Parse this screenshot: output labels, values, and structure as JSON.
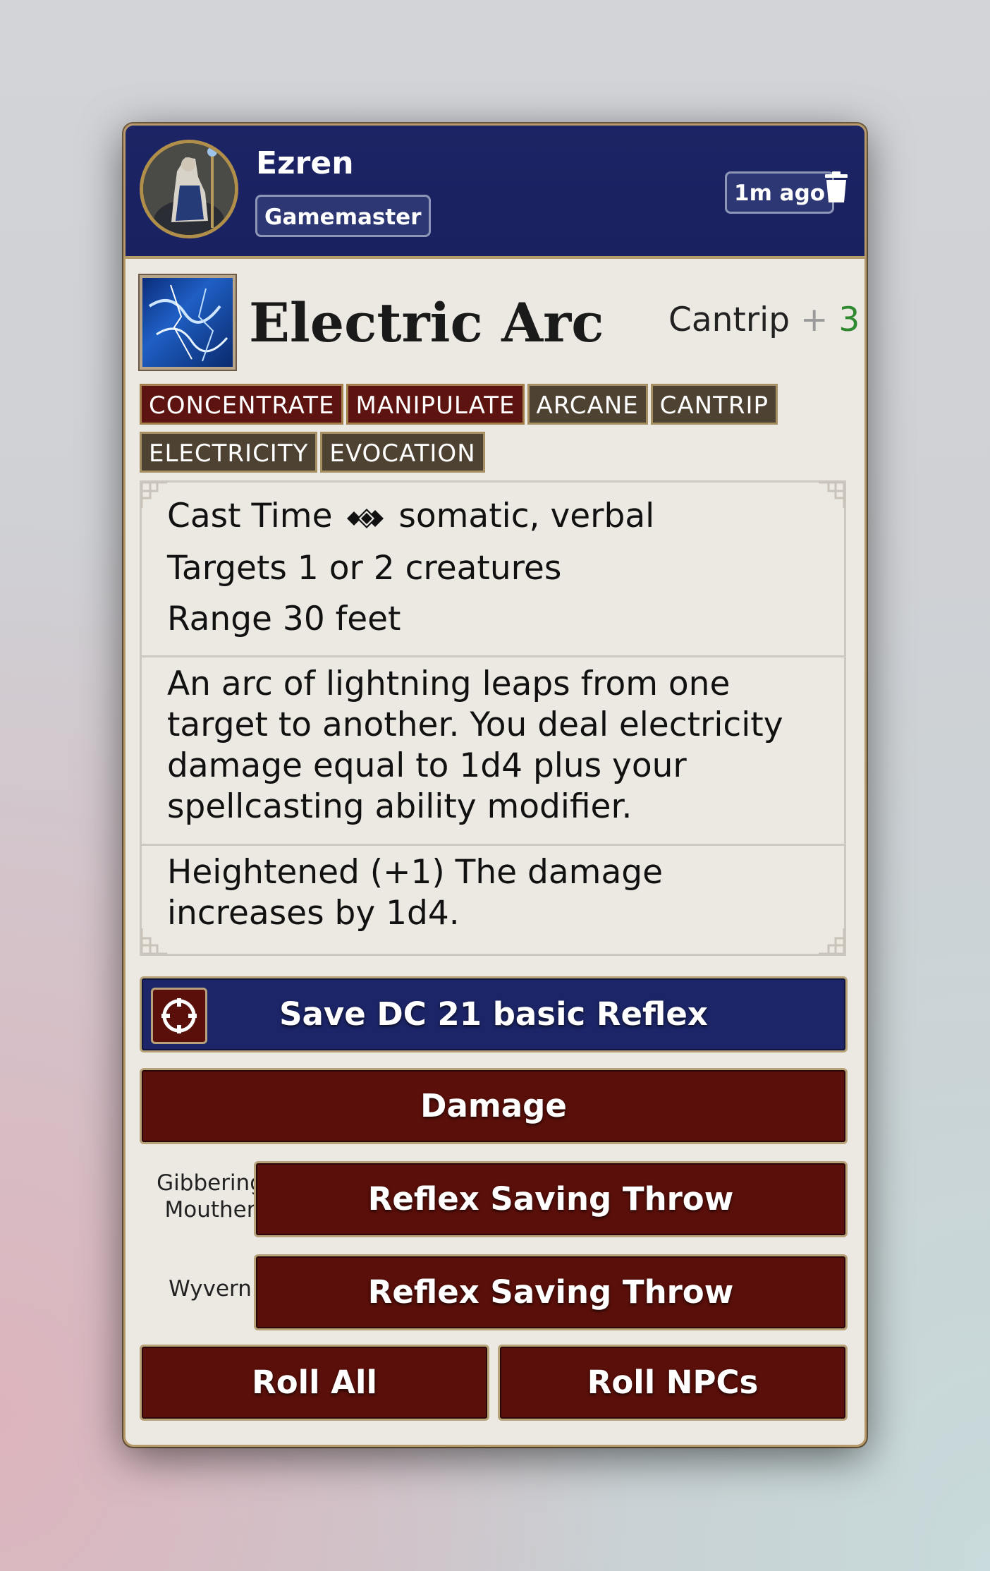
{
  "message": {
    "speaker": "Ezren",
    "role": "Gamemaster",
    "timestamp": "1m ago"
  },
  "spell": {
    "name": "Electric Arc",
    "level_type": "Cantrip",
    "level_separator": "+",
    "level": "3",
    "traits": [
      {
        "label": "CONCENTRATE",
        "style": "red"
      },
      {
        "label": "MANIPULATE",
        "style": "red"
      },
      {
        "label": "ARCANE",
        "style": "tan"
      },
      {
        "label": "CANTRIP",
        "style": "tan"
      },
      {
        "label": "ELECTRICITY",
        "style": "tan"
      },
      {
        "label": "EVOCATION",
        "style": "tan"
      }
    ],
    "cast_time_label": "Cast Time",
    "cast_time_value": "somatic, verbal",
    "targets_label": "Targets",
    "targets_value": "1 or 2 creatures",
    "range_label": "Range",
    "range_value": "30 feet",
    "description": "An arc of lightning leaps from one target to another. You deal electricity damage equal to 1d4 plus your spellcasting ability modifier.",
    "heightened_label": "Heightened (+1)",
    "heightened_text": "The damage increases by 1d4."
  },
  "buttons": {
    "save": "Save DC 21 basic Reflex",
    "damage": "Damage",
    "roll_all": "Roll All",
    "roll_npcs": "Roll NPCs"
  },
  "npcs": [
    {
      "name": "Gibbering Mouther",
      "button": "Reflex Saving Throw"
    },
    {
      "name": "Wyvern",
      "button": "Reflex Saving Throw"
    }
  ],
  "colors": {
    "header_blue": "#1c2465",
    "button_red": "#5a0f0a",
    "level_green": "#2f8a2f"
  },
  "icons": [
    "trash-icon",
    "target-icon",
    "two-actions-icon"
  ]
}
